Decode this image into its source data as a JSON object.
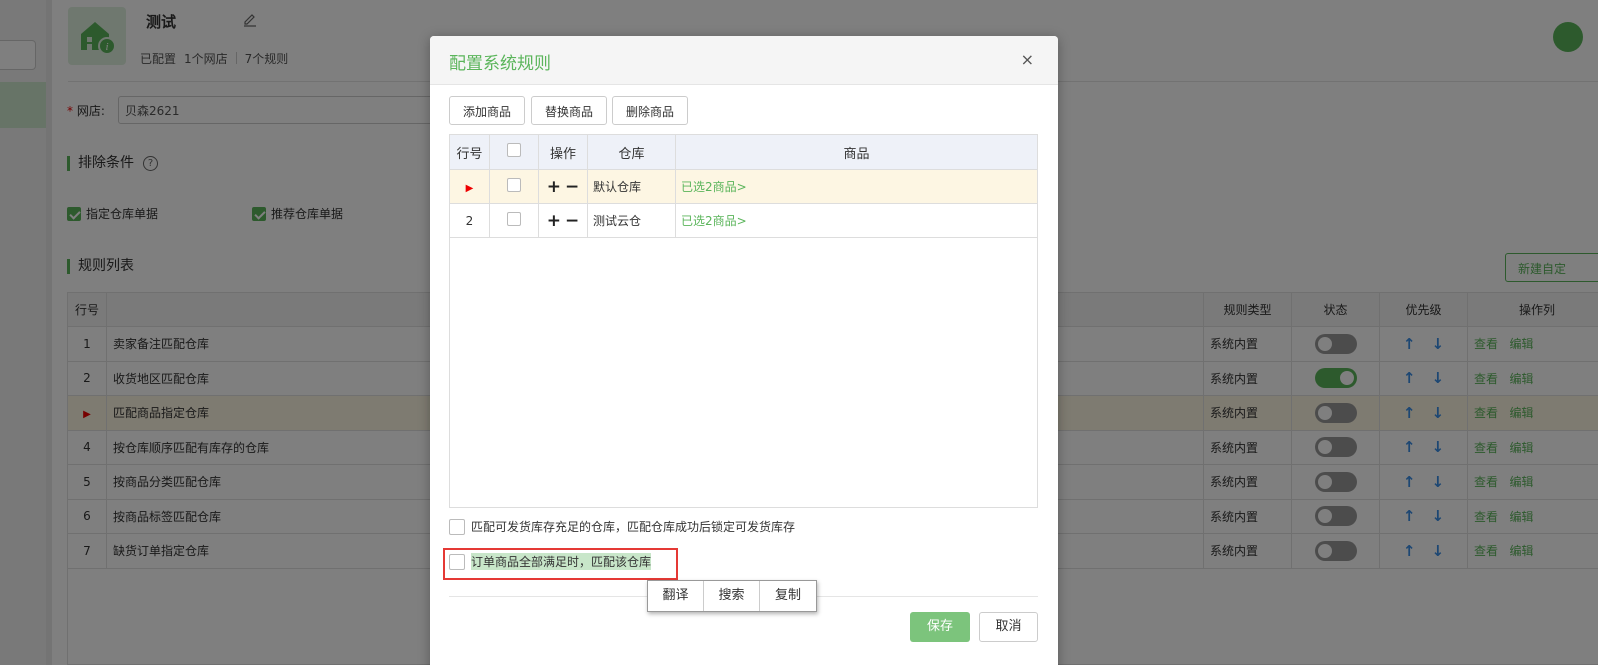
{
  "header": {
    "title": "测试",
    "configured": "已配置",
    "shop_count": "1个网店",
    "rule_count": "7个规则"
  },
  "form": {
    "shop_label": "网店:",
    "shop_required": "*",
    "shop_value": "贝森2621"
  },
  "exclude": {
    "title": "排除条件",
    "help": "?",
    "options": [
      {
        "label": "指定仓库单据",
        "checked": true
      },
      {
        "label": "推荐仓库单据",
        "checked": true
      }
    ]
  },
  "rules": {
    "title": "规则列表",
    "new_button": "新建自定",
    "headers": {
      "no": "行号",
      "type": "规则类型",
      "state": "状态",
      "priority": "优先级",
      "ops": "操作列"
    },
    "rows": [
      {
        "no": "1",
        "name": "卖家备注匹配仓库",
        "type": "系统内置",
        "on": false,
        "view": "查看",
        "edit": "编辑"
      },
      {
        "no": "2",
        "name": "收货地区匹配仓库",
        "type": "系统内置",
        "on": true,
        "view": "查看",
        "edit": "编辑"
      },
      {
        "no": "",
        "name": "匹配商品指定仓库",
        "type": "系统内置",
        "on": false,
        "view": "查看",
        "edit": "编辑",
        "current": true
      },
      {
        "no": "4",
        "name": "按仓库顺序匹配有库存的仓库",
        "type": "系统内置",
        "on": false,
        "view": "查看",
        "edit": "编辑"
      },
      {
        "no": "5",
        "name": "按商品分类匹配仓库",
        "type": "系统内置",
        "on": false,
        "view": "查看",
        "edit": "编辑"
      },
      {
        "no": "6",
        "name": "按商品标签匹配仓库",
        "type": "系统内置",
        "on": false,
        "view": "查看",
        "edit": "编辑"
      },
      {
        "no": "7",
        "name": "缺货订单指定仓库",
        "type": "系统内置",
        "on": false,
        "view": "查看",
        "edit": "编辑"
      }
    ]
  },
  "modal": {
    "title": "配置系统规则",
    "close": "×",
    "buttons": {
      "add": "添加商品",
      "replace": "替换商品",
      "delete": "删除商品"
    },
    "table": {
      "headers": {
        "no": "行号",
        "op": "操作",
        "warehouse": "仓库",
        "goods": "商品"
      },
      "rows": [
        {
          "no": "",
          "warehouse": "默认仓库",
          "goods": "已选2商品>",
          "current": true
        },
        {
          "no": "2",
          "warehouse": "测试云仓",
          "goods": "已选2商品>"
        }
      ]
    },
    "option1": "匹配可发货库存充足的仓库，匹配仓库成功后锁定可发货库存",
    "option2": "订单商品全部满足时，匹配该仓库",
    "context_menu": [
      "翻译",
      "搜索",
      "复制"
    ],
    "save": "保存",
    "cancel": "取消"
  },
  "colors": {
    "accent": "#5bb55b",
    "arrow": "#3a8ee6",
    "highlight_border": "#e53935"
  }
}
